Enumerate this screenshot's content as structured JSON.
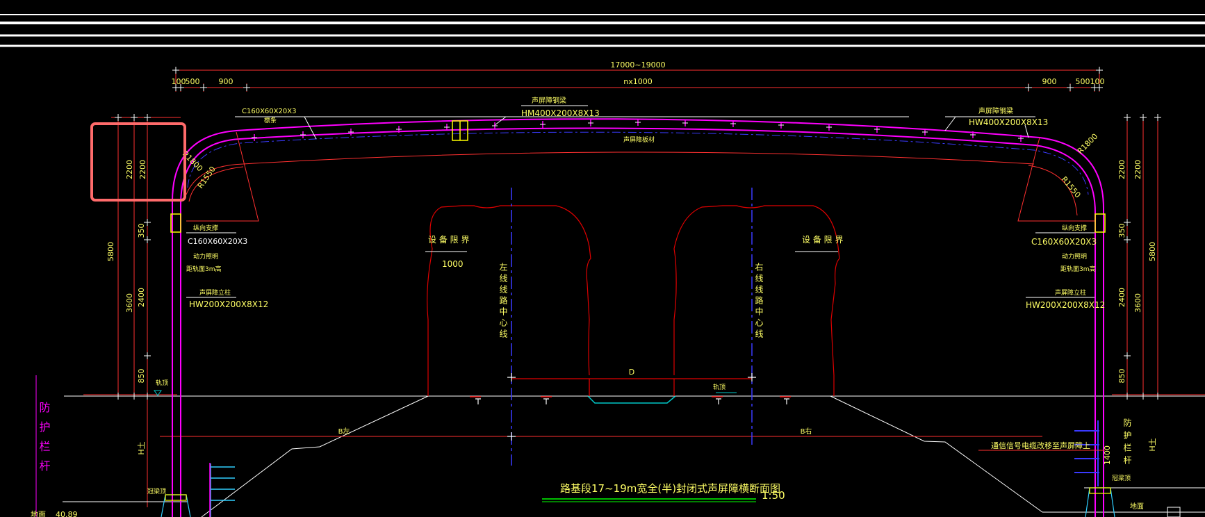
{
  "dims": {
    "overall": "17000~19000",
    "seg_100_left": "100",
    "seg_500_left": "500",
    "seg_900_left": "900",
    "seg_middle": "nx1000",
    "seg_900_right": "900",
    "seg_500_right": "500",
    "seg_100_right": "100",
    "left_2200_a": "2200",
    "left_2200_b": "2200",
    "left_5800": "5800",
    "left_350": "350",
    "left_3600": "3600",
    "left_2400": "2400",
    "left_850": "850",
    "left_h_tu": "H土",
    "right_2200_a": "2200",
    "right_2200_b": "2200",
    "right_5800": "5800",
    "right_350": "350",
    "right_2400": "2400",
    "right_3600": "3600",
    "right_850": "850",
    "right_1400": "1400",
    "right_h_tu": "H土",
    "radius_left_outer": "R1800",
    "radius_left_inner": "R1550",
    "radius_right_outer": "R1800",
    "radius_right_inner": "R1550",
    "equip_left_value": "1000",
    "track_gap": "D",
    "b_left": "B左",
    "b_right": "B右"
  },
  "labels": {
    "left_beam_title": "C160X60X20X3",
    "left_beam_sub": "檩条",
    "top_beam_title": "声屏障钢梁",
    "top_beam_size": "HM400X200X8X13",
    "right_beam_title": "声屏障钢梁",
    "right_beam_size": "HW400X200X8X13",
    "arch_inner_note": "声屏障板材",
    "left_purlin_title": "纵向支撑",
    "left_purlin_size": "C160X60X20X3",
    "left_light": "动力照明",
    "left_light_sub": "距轨面3m高",
    "left_column_title": "声屏障立柱",
    "left_column_size": "HW200X200X8X12",
    "right_purlin_title": "纵向支撑",
    "right_purlin_size": "C160X60X20X3",
    "right_light": "动力照明",
    "right_light_sub": "距轨面3m高",
    "right_column_title": "声屏障立柱",
    "right_column_size": "HW200X200X8X12",
    "equip_left": "设 备 限 界",
    "equip_right": "设 备 限 界",
    "left_line": "左线线路中心线",
    "right_line": "右线线路中心线",
    "rail_left": "轨顶",
    "rail_right": "轨顶",
    "guardrail_left": "防护栏杆",
    "guardrail_right": "防护栏杆",
    "cable_note": "通信信号电缆改移至声屏障上",
    "base_left": "冠梁顶",
    "base_right": "冠梁顶",
    "ground_left": "地面",
    "ground_value": "40.89",
    "ground_right": "地面"
  },
  "title": {
    "text": "路基段17~19m宽全(半)封闭式声屏障横断面图",
    "scale": "1:50"
  },
  "colors": {
    "background": "#000000",
    "structure": "#ff00ff",
    "dimension": "#ffff00",
    "clearance": "#e00000",
    "centerline": "#3030ff",
    "ground": "#ffffff",
    "drain": "#00c8c8",
    "highlight": "#ff6b6b"
  }
}
